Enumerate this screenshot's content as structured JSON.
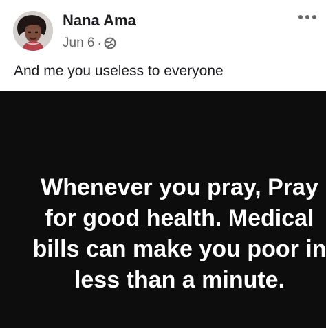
{
  "post": {
    "author": "Nana Ama",
    "date": "Jun 6",
    "separator": "·",
    "privacy_icon": "globe-icon",
    "more_icon": "more-options-icon",
    "text": "And me you useless to everyone",
    "image": {
      "caption_lines": [
        "Whenever you pray, Pray",
        "for good health. Medical",
        "bills can make you poor in",
        "less than a minute."
      ]
    }
  },
  "colors": {
    "name_text": "#1c1e21",
    "meta_text": "#65676b",
    "image_background": "#0d0d0d",
    "caption_text": "#ffffff"
  }
}
